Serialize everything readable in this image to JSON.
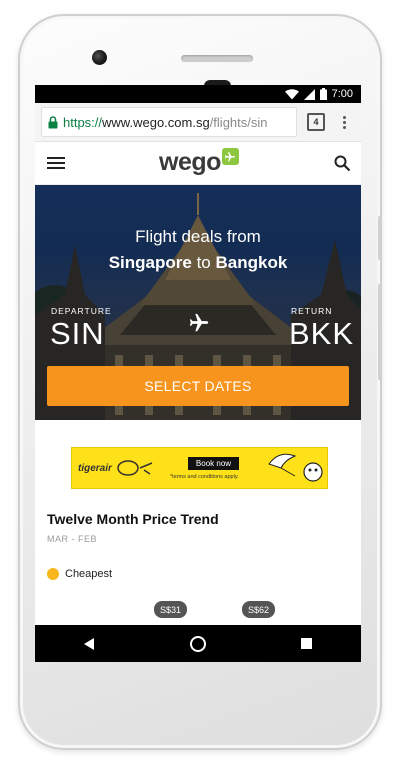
{
  "status_bar": {
    "time": "7:00"
  },
  "browser": {
    "url_protocol": "https://",
    "url_domain": "www.wego.com.sg",
    "url_path": "/flights/sin",
    "tab_count": "4"
  },
  "site": {
    "logo_text": "wego"
  },
  "hero": {
    "title": "Flight deals from",
    "origin_city": "Singapore",
    "connector": "to",
    "destination_city": "Bangkok",
    "departure_label": "DEPARTURE",
    "departure_code": "SIN",
    "return_label": "RETURN",
    "return_code": "BKK",
    "cta_label": "SELECT DATES"
  },
  "ad": {
    "brand": "tigerair",
    "cta": "Book now",
    "terms": "*terms and conditions apply."
  },
  "trend": {
    "title": "Twelve Month Price Trend",
    "range": "MAR - FEB",
    "legend_label": "Cheapest",
    "prices": [
      "S$31",
      "S$62"
    ]
  },
  "colors": {
    "accent_orange": "#f7941d",
    "brand_green": "#8dc63f",
    "cheapest_dot": "#f8b71c",
    "ad_yellow": "#ffe11a"
  },
  "icons": {
    "lock": "lock-icon",
    "menu": "hamburger-icon",
    "search": "search-icon",
    "plane": "airplane-icon",
    "nav_back": "back-triangle-icon",
    "nav_home": "home-circle-icon",
    "nav_recents": "recents-square-icon"
  }
}
